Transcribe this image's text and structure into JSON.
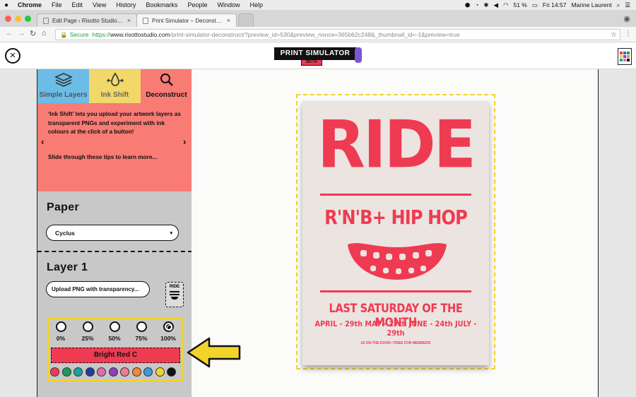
{
  "menubar": {
    "apple": "",
    "app": "Chrome",
    "items": [
      "File",
      "Edit",
      "View",
      "History",
      "Bookmarks",
      "People",
      "Window",
      "Help"
    ],
    "battery": "51 %",
    "clock": "Fri 14:57",
    "user": "Marine Laurent"
  },
  "tabs": [
    {
      "label": "Edit Page ‹ Risotto Studio — W",
      "close": "×"
    },
    {
      "label": "Print Simulator – Deconstruct",
      "close": "×"
    }
  ],
  "address": {
    "secure": "Secure",
    "url_scheme": "https://",
    "url_host": "www.risottostudio.com",
    "url_path": "/print-simulator-deconstruct/?preview_id=530&preview_nonce=365b62c248&_thumbnail_id=-1&preview=true"
  },
  "header": {
    "close": "×",
    "logo": "PRINT SIMULATOR",
    "beta": "BETA"
  },
  "modes": [
    {
      "label": "Simple Layers",
      "color": "#6bbde8"
    },
    {
      "label": "Ink Shift",
      "color": "#f2d868"
    },
    {
      "label": "Deconstruct",
      "color": "#f87b74"
    }
  ],
  "tip": {
    "text": "‘Ink Shift’ lets you upload your artwork layers as transparent PNGs and experiment with ink colours at the click of a button!",
    "cta": "Slide through these tips to learn more...",
    "prev": "‹",
    "next": "›"
  },
  "paper": {
    "title": "Paper",
    "selected": "Cyclus",
    "caret": "▾"
  },
  "layer": {
    "title": "Layer 1",
    "upload_label": "Upload PNG with transparency...",
    "thumb_text": "RIDE"
  },
  "opacity": {
    "options": [
      "0%",
      "25%",
      "50%",
      "75%",
      "100%"
    ],
    "selected_index": 4
  },
  "ink": {
    "name": "Bright Red C",
    "name_color": "#ef3b52",
    "swatches": [
      "#ef3b52",
      "#1d9a57",
      "#17a3a3",
      "#1f3f9a",
      "#e06fa8",
      "#8f3fb8",
      "#f07a9a",
      "#f28a2e",
      "#3b9bd8",
      "#f2d32a",
      "#111111"
    ]
  },
  "poster": {
    "title": "RIDE",
    "subtitle": "R'N'B+ HIP HOP",
    "headline": "LAST SATURDAY OF THE MONTH",
    "dates": "APRIL - 29th   MAY - 27th   JUNE - 24th   JULY - 29th",
    "footer": "£5 ON THE DOOR / FREE FOR MEMBERS",
    "ink_color": "#ef3b52",
    "paper_color": "#ece4e1"
  },
  "accents": {
    "highlight": "#f2d32a"
  }
}
